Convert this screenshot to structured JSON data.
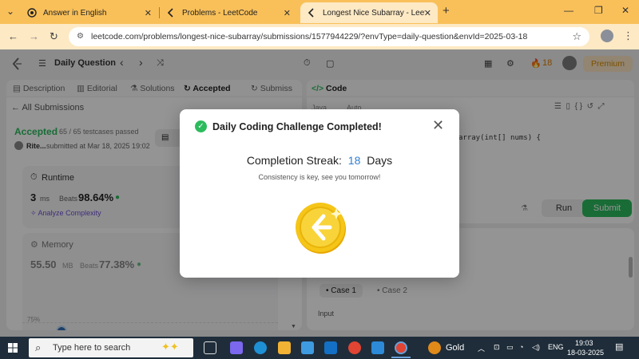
{
  "browser": {
    "tabs": [
      {
        "title": "Answer in English",
        "icon": "chatgpt-icon"
      },
      {
        "title": "Problems - LeetCode",
        "icon": "leetcode-icon"
      },
      {
        "title": "Longest Nice Subarray - LeetCo",
        "icon": "leetcode-icon",
        "active": true
      }
    ],
    "url": "leetcode.com/problems/longest-nice-subarray/submissions/1577944229/?envType=daily-question&envId=2025-03-18"
  },
  "lc_header": {
    "title": "Daily Question",
    "streak_count": "18",
    "premium_label": "Premium"
  },
  "left_panel": {
    "tabs": [
      "Description",
      "Editorial",
      "Solutions",
      "Accepted",
      "Submiss"
    ],
    "all_submissions": "All Submissions",
    "status": "Accepted",
    "testcases": "65 / 65 testcases passed",
    "author": "Rite...",
    "submitted_at": "submitted at Mar 18, 2025 19:02",
    "runtime": {
      "label": "Runtime",
      "value": "3",
      "unit": "ms",
      "beats_label": "Beats",
      "beats": "98.64%",
      "analyze": "Analyze Complexity"
    },
    "memory": {
      "label": "Memory",
      "value": "55.50",
      "unit": "MB",
      "beats_label": "Beats",
      "beats": "77.38%"
    },
    "chart_label": "75%"
  },
  "right_panel": {
    "code_label": "Code",
    "language": "Java",
    "auto": "Auto",
    "code_snippet": "array(int[] nums) {",
    "run_label": "Run",
    "submit_label": "Submit",
    "cases": [
      "Case 1",
      "Case 2"
    ],
    "input_label": "Input"
  },
  "modal": {
    "title": "Daily Coding Challenge Completed!",
    "streak_label": "Completion Streak:",
    "streak_value": "18",
    "streak_unit": "Days",
    "subtitle": "Consistency is key, see you tomorrow!"
  },
  "taskbar": {
    "search_placeholder": "Type here to search",
    "weather": "Gold",
    "language": "ENG",
    "time": "19:03",
    "date": "18-03-2025"
  },
  "colors": {
    "accent_green": "#2cbb5d",
    "streak_blue": "#2f7fd0",
    "browser_chrome": "#f9c05a",
    "coin_gold": "#f5c518"
  }
}
